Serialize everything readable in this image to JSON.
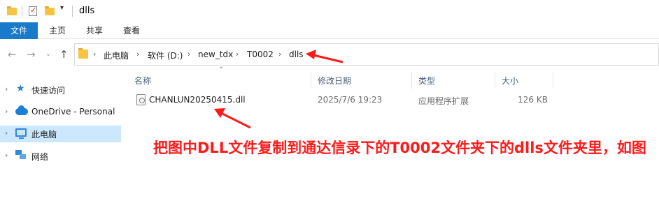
{
  "window": {
    "title": "dlls"
  },
  "ribbon": {
    "tabs": [
      {
        "label": "文件",
        "active": true
      },
      {
        "label": "主页"
      },
      {
        "label": "共享"
      },
      {
        "label": "查看"
      }
    ]
  },
  "nav": {
    "back_icon": "arrow-left-icon",
    "forward_icon": "arrow-right-icon",
    "recent_icon": "chevron-down-icon",
    "up_icon": "arrow-up-icon"
  },
  "address": {
    "crumbs": [
      "此电脑",
      "软件 (D:)",
      "new_tdx",
      "T0002",
      "dlls"
    ]
  },
  "sidebar": {
    "items": [
      {
        "label": "快速访问",
        "icon": "star-icon"
      },
      {
        "label": "OneDrive - Personal",
        "icon": "cloud-icon"
      },
      {
        "label": "此电脑",
        "icon": "pc-icon",
        "selected": true
      },
      {
        "label": "网络",
        "icon": "network-icon"
      }
    ]
  },
  "file_list": {
    "columns": {
      "name": "名称",
      "date": "修改日期",
      "type": "类型",
      "size": "大小"
    },
    "rows": [
      {
        "name": "CHANLUN20250415.dll",
        "date": "2025/7/6 19:23",
        "type": "应用程序扩展",
        "size": "126 KB",
        "icon": "dll-file-icon"
      }
    ]
  },
  "annotation": {
    "text": "把图中DLL文件复制到通达信录下的T0002文件夹下的dlls文件夹里，如图",
    "color": "#ff1a1a"
  },
  "colors": {
    "accent": "#1979ca",
    "selection": "#cce8ff",
    "annotation": "#ff1a1a"
  }
}
